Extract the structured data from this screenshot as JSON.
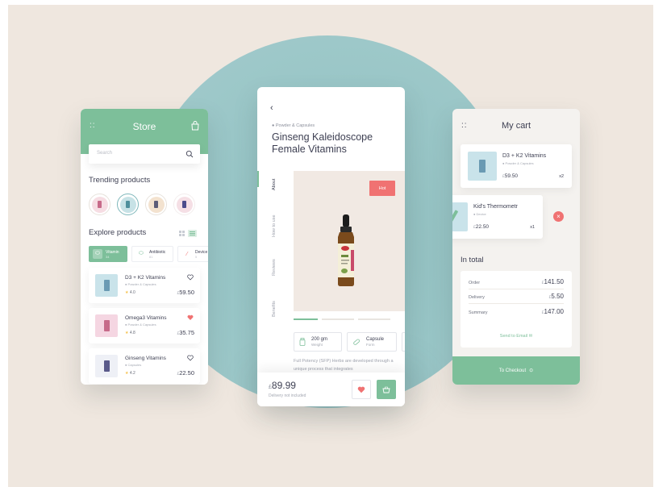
{
  "colors": {
    "accent": "#7dbf9a",
    "alert": "#f07272",
    "circle": "#98c5c6",
    "background": "#efe7df"
  },
  "store": {
    "title": "Store",
    "search_placeholder": "Search",
    "trending_title": "Trending products",
    "explore_title": "Explore products",
    "chips": [
      {
        "label": "Vitamin",
        "count": "34"
      },
      {
        "label": "Antibiotic",
        "count": "81"
      },
      {
        "label": "Device",
        "count": "5"
      }
    ],
    "products": [
      {
        "name": "D3 + K2 Vitamins",
        "category": "Powder & Capsules",
        "rating": "4.0",
        "price": "59.50",
        "currency": "£",
        "favorite": false
      },
      {
        "name": "Omega3 Vitamins",
        "category": "Powder & Capsules",
        "rating": "4.8",
        "price": "35.75",
        "currency": "£",
        "favorite": true
      },
      {
        "name": "Ginseng Vitamins",
        "category": "Capsules",
        "rating": "4.2",
        "price": "22.50",
        "currency": "£",
        "favorite": false
      }
    ]
  },
  "detail": {
    "category": "Powder & Capsules",
    "title": "Ginseng Kaleidoscope Female Vitamins",
    "tabs": [
      "About",
      "How to use",
      "Reviews",
      "Benefits"
    ],
    "badge": "Hot",
    "specs": [
      {
        "value": "200 gm",
        "key": "Weight"
      },
      {
        "value": "Capsule",
        "key": "Form"
      }
    ],
    "description": "Full Potency (SFP) Herbs are developed through a unique process that integrates",
    "currency": "£",
    "price": "89.99",
    "price_note": "Delivery not included"
  },
  "cart": {
    "title": "My cart",
    "items": [
      {
        "name": "D3 + K2 Vitamins",
        "category": "Powder & Capsules",
        "currency": "£",
        "price": "59.50",
        "qty": "x2"
      },
      {
        "name": "Kid's Thermometr",
        "category": "Device",
        "currency": "£",
        "price": "22.50",
        "qty": "x1"
      }
    ],
    "in_total_title": "In total",
    "totals": [
      {
        "label": "Order",
        "currency": "£",
        "value": "141.50"
      },
      {
        "label": "Delivery",
        "currency": "£",
        "value": "5.50"
      },
      {
        "label": "Summary",
        "currency": "£",
        "value": "147.00"
      }
    ],
    "send_label": "Send to Email",
    "checkout_label": "To Checkout"
  }
}
